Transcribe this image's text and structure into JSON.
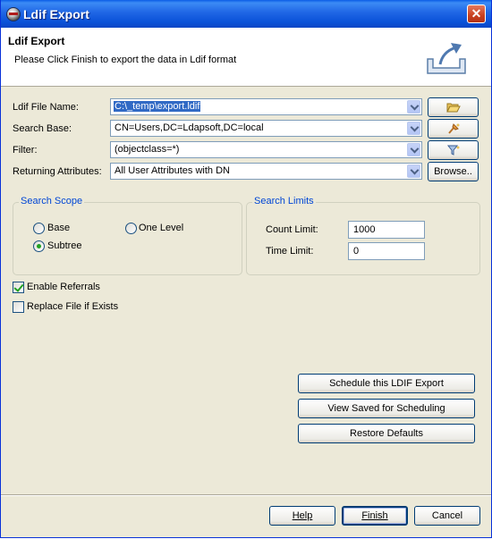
{
  "window": {
    "title": "Ldif Export",
    "close_glyph": "✕"
  },
  "header": {
    "title": "Ldif Export",
    "description": "Please Click Finish to export the data in Ldif format",
    "icon": "export-icon"
  },
  "form": {
    "file_name_label": "Ldif File Name:",
    "file_name_value": "C:\\_temp\\export.ldif",
    "search_base_label": "Search Base:",
    "search_base_value": "CN=Users,DC=Ldapsoft,DC=local",
    "filter_label": "Filter:",
    "filter_value": "(objectclass=*)",
    "returning_attributes_label": "Returning Attributes:",
    "returning_attributes_value": "All User Attributes with DN",
    "browse_label": "Browse.."
  },
  "search_scope": {
    "title": "Search Scope",
    "options": [
      {
        "label": "Base",
        "selected": false
      },
      {
        "label": "One Level",
        "selected": false
      },
      {
        "label": "Subtree",
        "selected": true
      }
    ]
  },
  "search_limits": {
    "title": "Search Limits",
    "count_label": "Count Limit:",
    "count_value": "1000",
    "time_label": "Time Limit:",
    "time_value": "0"
  },
  "options": {
    "enable_referrals_label": "Enable Referrals",
    "enable_referrals_checked": true,
    "replace_file_label": "Replace File if Exists",
    "replace_file_checked": false
  },
  "actions": {
    "schedule_label": "Schedule this LDIF Export",
    "view_saved_label": "View Saved for Scheduling",
    "restore_label": "Restore Defaults"
  },
  "footer": {
    "help_label": "Help",
    "finish_label": "Finish",
    "cancel_label": "Cancel"
  },
  "colors": {
    "title_bar": "#0951d8",
    "group_title": "#0046d5",
    "selection": "#316ac5",
    "close": "#c8401f"
  }
}
